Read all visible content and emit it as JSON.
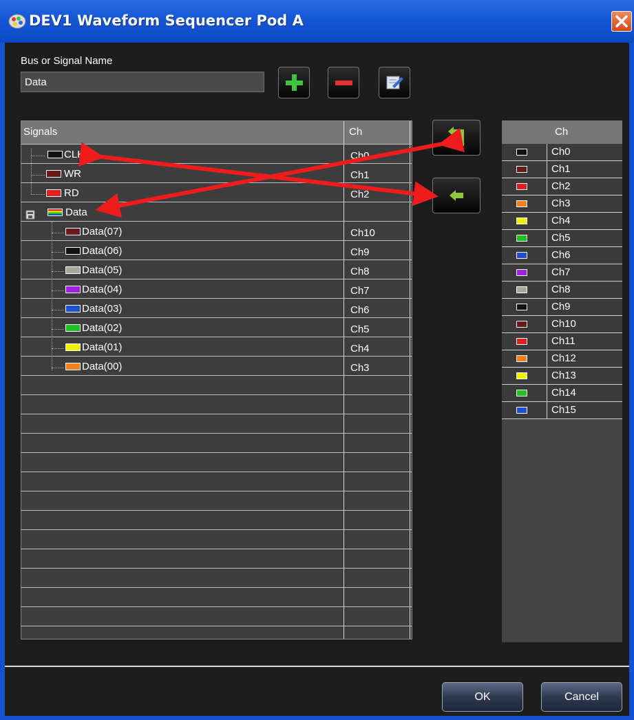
{
  "window": {
    "title": "DEV1 Waveform Sequencer Pod A"
  },
  "name_field": {
    "label": "Bus or Signal Name",
    "value": "Data"
  },
  "signals_table": {
    "headers": {
      "signals": "Signals",
      "ch": "Ch"
    },
    "rows": [
      {
        "label": "CLK",
        "ch": "Ch0",
        "color": "#121212"
      },
      {
        "label": "WR",
        "ch": "Ch1",
        "color": "#6a1a1a"
      },
      {
        "label": "RD",
        "ch": "Ch2",
        "color": "#e02020"
      },
      {
        "label": "Data",
        "ch": "",
        "color": "bus"
      },
      {
        "label": "Data(07)",
        "ch": "Ch10",
        "color": "#6a1a1a"
      },
      {
        "label": "Data(06)",
        "ch": "Ch9",
        "color": "#121212"
      },
      {
        "label": "Data(05)",
        "ch": "Ch8",
        "color": "#a8a89a"
      },
      {
        "label": "Data(04)",
        "ch": "Ch7",
        "color": "#a020e0"
      },
      {
        "label": "Data(03)",
        "ch": "Ch6",
        "color": "#2050d0"
      },
      {
        "label": "Data(02)",
        "ch": "Ch5",
        "color": "#20c020"
      },
      {
        "label": "Data(01)",
        "ch": "Ch4",
        "color": "#f0f000"
      },
      {
        "label": "Data(00)",
        "ch": "Ch3",
        "color": "#f08020"
      }
    ]
  },
  "channel_list": {
    "header": "Ch",
    "items": [
      {
        "label": "Ch0",
        "color": "#121212"
      },
      {
        "label": "Ch1",
        "color": "#6a1a1a"
      },
      {
        "label": "Ch2",
        "color": "#e02020"
      },
      {
        "label": "Ch3",
        "color": "#f08020"
      },
      {
        "label": "Ch4",
        "color": "#f0f000"
      },
      {
        "label": "Ch5",
        "color": "#20c020"
      },
      {
        "label": "Ch6",
        "color": "#2050d0"
      },
      {
        "label": "Ch7",
        "color": "#a020e0"
      },
      {
        "label": "Ch8",
        "color": "#a8a89a"
      },
      {
        "label": "Ch9",
        "color": "#121212"
      },
      {
        "label": "Ch10",
        "color": "#6a1a1a"
      },
      {
        "label": "Ch11",
        "color": "#e02020"
      },
      {
        "label": "Ch12",
        "color": "#f08020"
      },
      {
        "label": "Ch13",
        "color": "#f0f000"
      },
      {
        "label": "Ch14",
        "color": "#20c020"
      },
      {
        "label": "Ch15",
        "color": "#2050d0"
      }
    ]
  },
  "buttons": {
    "ok": "OK",
    "cancel": "Cancel"
  },
  "icons": {
    "add": "plus-icon",
    "remove": "minus-icon",
    "edit": "edit-icon",
    "swap": "swap-arrows-icon",
    "assign": "left-arrow-icon",
    "close": "close-icon"
  },
  "colors": {
    "annotation_arrow": "#ee1c1c",
    "title_bar": "#1658d8"
  }
}
